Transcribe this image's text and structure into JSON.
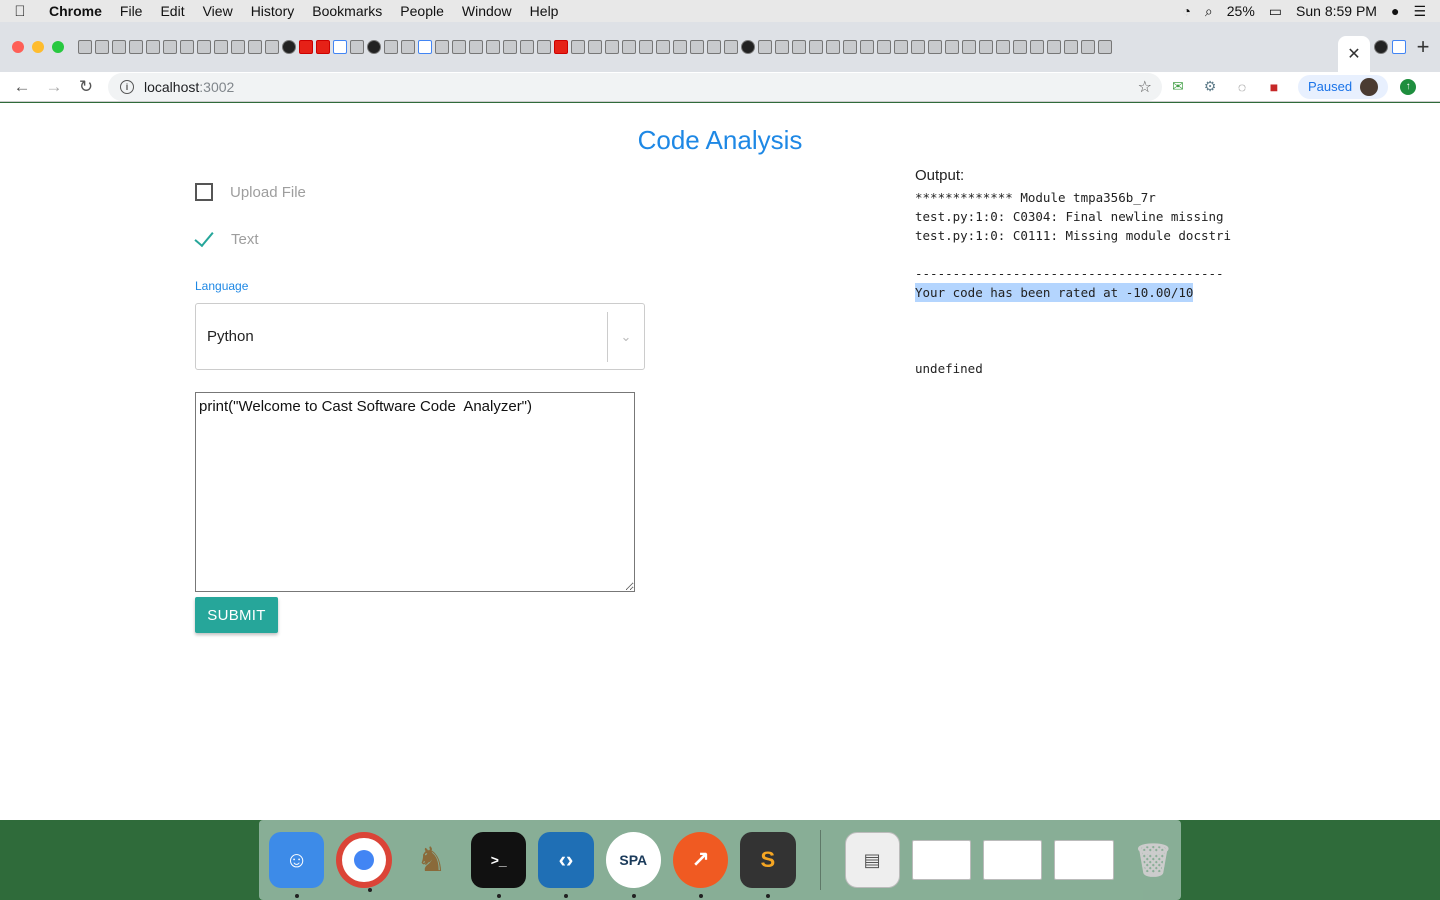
{
  "menubar": {
    "items": [
      "Chrome",
      "File",
      "Edit",
      "View",
      "History",
      "Bookmarks",
      "People",
      "Window",
      "Help"
    ],
    "battery": "25%",
    "clock": "Sun 8:59 PM"
  },
  "browser": {
    "url_host": "localhost",
    "url_port": ":3002",
    "profile_status": "Paused"
  },
  "page": {
    "title": "Code Analysis",
    "option_upload": "Upload File",
    "option_text": "Text",
    "language_label": "Language",
    "language_value": "Python",
    "code_value": "print(\"Welcome to Cast Software Code  Analyzer\")",
    "submit_label": "SUBMIT"
  },
  "output": {
    "label": "Output:",
    "lines": [
      "************* Module tmpa356b_7r",
      "test.py:1:0: C0304: Final newline missing",
      "test.py:1:0: C0111: Missing module docstri"
    ],
    "rule": "-----------------------------------------",
    "rating": "Your code has been rated at -10.00/10",
    "extra": "undefined"
  },
  "colors": {
    "accent_blue": "#1e88e5",
    "teal": "#26a69a"
  }
}
